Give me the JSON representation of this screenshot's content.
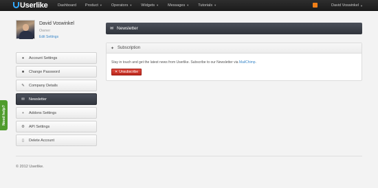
{
  "brand": {
    "name": "Userlike"
  },
  "nav": {
    "items": [
      {
        "label": "Dashboard",
        "dropdown": false
      },
      {
        "label": "Product",
        "dropdown": true
      },
      {
        "label": "Operators",
        "dropdown": true
      },
      {
        "label": "Widgets",
        "dropdown": true
      },
      {
        "label": "Messages",
        "dropdown": true
      },
      {
        "label": "Tutorials",
        "dropdown": true
      }
    ],
    "user_menu": "David Voswinkel"
  },
  "profile": {
    "name": "David Voswinkel",
    "role": "Owner",
    "edit_label": "Edit Settings"
  },
  "sidebar": {
    "items": [
      {
        "label": "Account Settings",
        "icon": "user-icon",
        "active": false
      },
      {
        "label": "Change Password",
        "icon": "lock-icon",
        "active": false
      },
      {
        "label": "Company Details",
        "icon": "pencil-icon",
        "active": false
      },
      {
        "label": "Newsletter",
        "icon": "envelope-icon",
        "active": true
      },
      {
        "label": "Addons Settings",
        "icon": "plus-icon",
        "active": false
      },
      {
        "label": "API Settings",
        "icon": "gear-icon",
        "active": false
      },
      {
        "label": "Delete Account",
        "icon": "trash-icon",
        "active": false
      }
    ]
  },
  "help_tab": "Need help?",
  "main": {
    "title": "Newsletter",
    "panel": {
      "title": "Subscription",
      "text": "Stay in touch and get the latest news from Userlike. Subscribe to our Newsletter via ",
      "link": "MailChimp",
      "text_end": ".",
      "button": "Unsubscribe"
    }
  },
  "footer": {
    "copyright": "© 2012 Userlike."
  },
  "colors": {
    "topbar": "#1c1c1c",
    "accent_link": "#3a87c8",
    "danger": "#c9342a",
    "help_green": "#4f9c2c",
    "rss_orange": "#f07f18"
  }
}
